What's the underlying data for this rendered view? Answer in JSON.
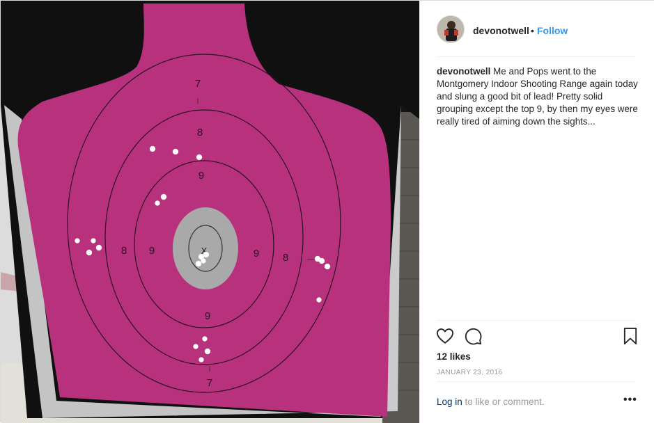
{
  "post": {
    "username": "devonotwell",
    "separator": "•",
    "follow_label": "Follow",
    "caption_user": "devonotwell",
    "caption_text": "Me and Pops went to the Montgomery Indoor Shooting Range again today and slung a good bit of lead! Pretty solid grouping except the top 9, by then my eyes were really tired of aiming down the sights...",
    "likes": "12 likes",
    "date": "January 23, 2016",
    "login_link": "Log in",
    "login_suffix": " to like or comment.",
    "more_label": "•••"
  },
  "icons": {
    "like": "heart-icon",
    "comment": "comment-icon",
    "save": "bookmark-icon",
    "more": "more-options-icon"
  },
  "target": {
    "ring_labels": {
      "seven_top": "7",
      "eight_top": "8",
      "nine_top": "9",
      "eight_left": "8",
      "nine_left": "9",
      "center": "X",
      "nine_right": "9",
      "eight_right": "8",
      "nine_bottom": "9",
      "seven_bottom": "7"
    }
  },
  "colors": {
    "target_pink": "#b8317d",
    "follow_blue": "#3897f0",
    "link_navy": "#003569"
  }
}
